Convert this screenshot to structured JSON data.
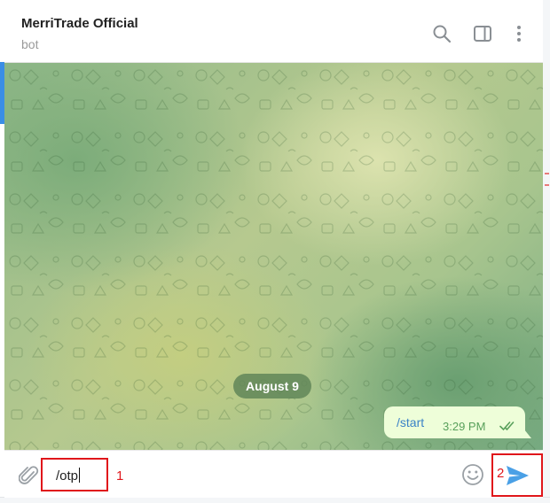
{
  "chat": {
    "title": "MerriTrade Official",
    "subtitle": "bot"
  },
  "header_icons": [
    "search-icon",
    "sidebar-toggle-icon",
    "more-vertical-icon"
  ],
  "date_separator": "August 9",
  "messages": [
    {
      "text": "/start",
      "time": "3:29 PM",
      "status": "read"
    }
  ],
  "composer": {
    "input_value": "/otp",
    "annotation_1": "1",
    "annotation_2": "2"
  },
  "colors": {
    "accent": "#3a8ee6",
    "send": "#4aa0e6",
    "highlight": "#e0161b",
    "bubble": "#eefed9",
    "read_check": "#58a05b"
  }
}
